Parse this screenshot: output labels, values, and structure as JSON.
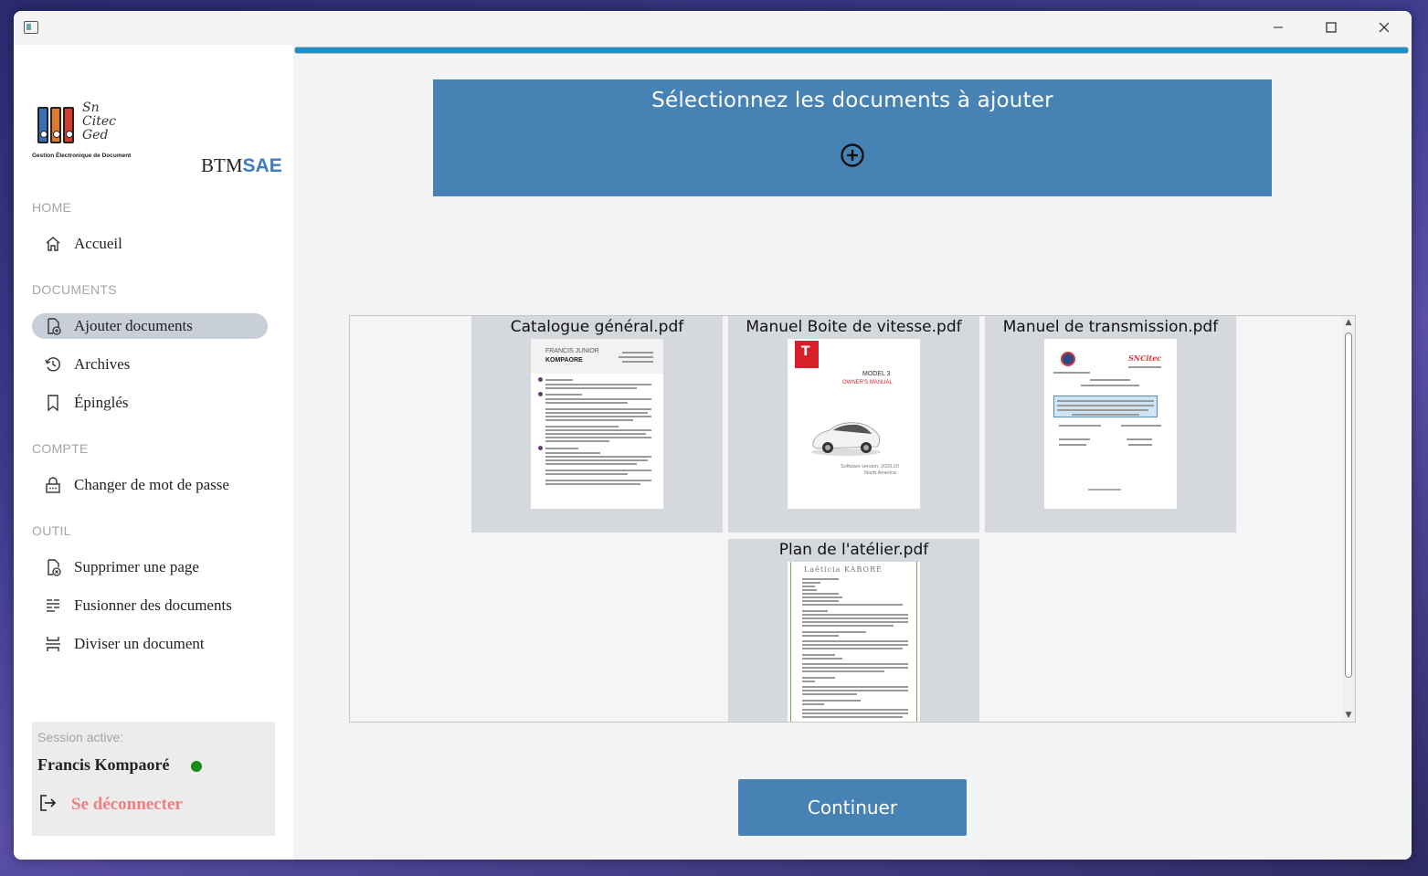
{
  "window": {
    "controls": [
      "minimize-icon",
      "maximize-icon",
      "close-icon"
    ]
  },
  "sidebar": {
    "logo": {
      "script_text": [
        "Sn",
        "Citec",
        "Ged"
      ],
      "caption": "Gestion Électronique de Document"
    },
    "brand": {
      "part1": "BTM",
      "part2": "SAE"
    },
    "sections": [
      {
        "title": "HOME",
        "items": [
          {
            "label": "Accueil",
            "icon": "home-icon"
          }
        ]
      },
      {
        "title": "DOCUMENTS",
        "items": [
          {
            "label": "Ajouter documents",
            "icon": "add-document-icon",
            "active": true
          },
          {
            "label": "Archives",
            "icon": "history-icon"
          },
          {
            "label": "Épinglés",
            "icon": "bookmark-icon"
          }
        ]
      },
      {
        "title": "COMPTE",
        "items": [
          {
            "label": "Changer de mot de passe",
            "icon": "lock-icon"
          }
        ]
      },
      {
        "title": "OUTIL",
        "items": [
          {
            "label": "Supprimer une page",
            "icon": "delete-page-icon"
          },
          {
            "label": "Fusionner des documents",
            "icon": "merge-icon"
          },
          {
            "label": "Diviser un document",
            "icon": "split-icon"
          }
        ]
      }
    ],
    "session": {
      "label": "Session active:",
      "user": "Francis Kompaoré",
      "status_color": "#1a8a1a",
      "logout_label": "Se déconnecter"
    }
  },
  "main": {
    "progress": 1.0,
    "drop_zone": {
      "title": "Sélectionnez les documents à ajouter",
      "icon": "add-circle-icon"
    },
    "documents": [
      {
        "name": "Catalogue général.pdf",
        "thumb": "cv",
        "thumb_text": {
          "name1": "FRANCIS JUNIOR",
          "name2": "KOMPAORE"
        }
      },
      {
        "name": "Manuel Boite de vitesse.pdf",
        "thumb": "tesla",
        "thumb_text": {
          "model": "MODEL 3",
          "manual": "OWNER'S MANUAL",
          "software": "Software version: 2020.20",
          "region": "North America"
        }
      },
      {
        "name": "Manuel de transmission.pdf",
        "thumb": "transmission",
        "thumb_text": {
          "logo": "SNCitec"
        }
      },
      {
        "name": "Plan de l'atélier.pdf",
        "thumb": "plan",
        "thumb_text": {
          "title": "Laëticia KABORÉ"
        }
      }
    ],
    "continue_label": "Continuer"
  },
  "colors": {
    "accent": "#4682b4",
    "progress": "#1e8fc7",
    "logout": "#f08080",
    "active_nav": "#c9cfd8"
  }
}
